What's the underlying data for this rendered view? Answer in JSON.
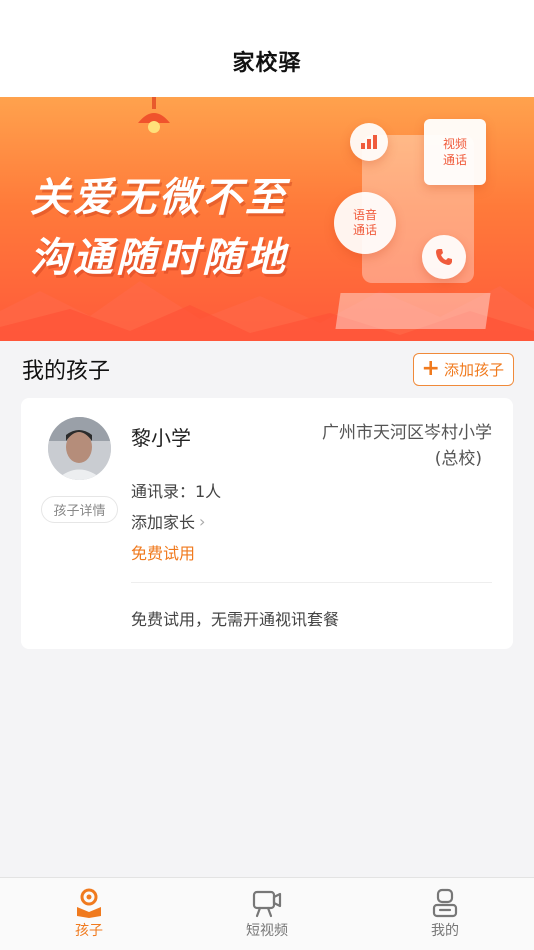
{
  "nav": {
    "title": "家校驿"
  },
  "banner": {
    "slogan_line1": "关爱无微不至",
    "slogan_line2": "沟通随时随地",
    "video_call_label": "视频\n通话",
    "voice_call_label": "语音\n通话"
  },
  "section": {
    "title": "我的孩子",
    "add_child_label": "添加孩子"
  },
  "child": {
    "name": "黎小学",
    "school_line1": "广州市天河区岑村小学",
    "school_line2": "(总校)",
    "detail_label": "孩子详情",
    "contacts": "通讯录：1人",
    "add_parent": "添加家长",
    "free_trial": "免费试用",
    "note": "免费试用，无需开通视讯套餐"
  },
  "tabbar": {
    "items": [
      {
        "label": "孩子",
        "icon": "child-icon",
        "active": true
      },
      {
        "label": "短视频",
        "icon": "video-icon",
        "active": false
      },
      {
        "label": "我的",
        "icon": "profile-icon",
        "active": false
      }
    ]
  },
  "colors": {
    "accent": "#f07a1e",
    "banner_top": "#ffa24d",
    "banner_bottom": "#ff5a3a"
  }
}
